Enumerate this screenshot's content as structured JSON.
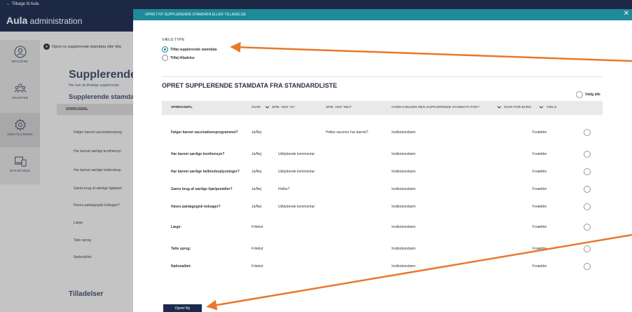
{
  "background": {
    "back_link": "← Tilbage til Aula",
    "brand_bold": "Aula",
    "brand_rest": " administration",
    "nav": [
      {
        "label": "BRUGERE",
        "icon": "user-icon"
      },
      {
        "label": "GRUPPER",
        "icon": "group-icon"
      },
      {
        "label": "INDSTILLINGER",
        "icon": "gear-icon"
      },
      {
        "label": "OPSÆTNING",
        "icon": "devices-icon"
      }
    ],
    "create_link": "Opret ny supplerende stamdata eller tilla",
    "page_title": "Supplerende st",
    "page_subtitle": "Her kan du tilvælge supplerende",
    "section_title": "Supplerende stamdat",
    "table_header": "SPØRGSMÅL",
    "rows": [
      "Følger barnet vaccinationsprog",
      "Har barnet særlige kosthensyn",
      "Har barnet særlige helbredsop",
      "Gøres brug af særlige hjælpem",
      "Haves pædagogisk ledsager?",
      "Læge:",
      "Talte sprog:",
      "Nationalitet:"
    ],
    "permissions_title": "Tilladelser"
  },
  "modal": {
    "title": "OPRET NY SUPPLERENDE STAMDATA ELLER TILLADELSE",
    "close_label": "✕",
    "type_label": "VÆLG TYPE",
    "type_options": [
      {
        "label": "Tilføj supplerende stamdata",
        "selected": true
      },
      {
        "label": "Tilføj tilladelse",
        "selected": false
      }
    ],
    "standard_list_title": "OPRET SUPPLERENDE STAMDATA FRA STANDARDLISTE",
    "select_all_label": "Vælg alle",
    "columns": {
      "question": "SPØRGSMÅL",
      "answer": "SVAR",
      "ja": "SPM. VED \"JA\"",
      "nej": "SPM. VED \"NEJ\"",
      "who": "HVEM GÆLDER DEN SUPPLERENDE STAMDATA FOR?",
      "answer_for": "SVAR FOR BARN",
      "choose": "VÆLG"
    },
    "rows": [
      {
        "question": "Følger barnet vaccinationsprogrammet?",
        "answer": "Ja/Nej",
        "ja": "",
        "nej": "Hvilke vacciner har barnet?",
        "who": "Institutionsbørn",
        "answer_for": "Forældre"
      },
      {
        "question": "Har barnet særlige kosthensyn?",
        "answer": "Ja/Nej",
        "ja": "Uddybende kommentar:",
        "nej": "",
        "who": "Institutionsbørn",
        "answer_for": "Forældre"
      },
      {
        "question": "Har barnet særlige helbredsoplysninger?",
        "answer": "Ja/Nej",
        "ja": "Uddybende kommentar:",
        "nej": "",
        "who": "Institutionsbørn",
        "answer_for": "Forældre"
      },
      {
        "question": "Gøres brug af særlige hjælpemidler?",
        "answer": "Ja/Nej",
        "ja": "Hvilke?",
        "nej": "",
        "who": "Institutionsbørn",
        "answer_for": "Forældre"
      },
      {
        "question": "Haves pædagogisk ledsager?",
        "answer": "Ja/Nej",
        "ja": "Uddybende kommentar:",
        "nej": "",
        "who": "Institutionsbørn",
        "answer_for": "Forældre"
      },
      {
        "question": "Læge:",
        "answer": "Fritekst",
        "ja": "",
        "nej": "",
        "who": "Institutionsbørn",
        "answer_for": "Forældre"
      },
      {
        "question": "Talte sprog:",
        "answer": "Fritekst",
        "ja": "",
        "nej": "",
        "who": "Institutionsbørn",
        "answer_for": "Forældre"
      },
      {
        "question": "Nationalitet:",
        "answer": "Fritekst",
        "ja": "",
        "nej": "",
        "who": "Institutionsbørn",
        "answer_for": "Forældre"
      }
    ],
    "submit_label": "Opret Ny"
  },
  "colors": {
    "modal_bar": "#1f8a9a",
    "topbar": "#1b2a4c",
    "annotation_arrow": "#e8782c"
  }
}
